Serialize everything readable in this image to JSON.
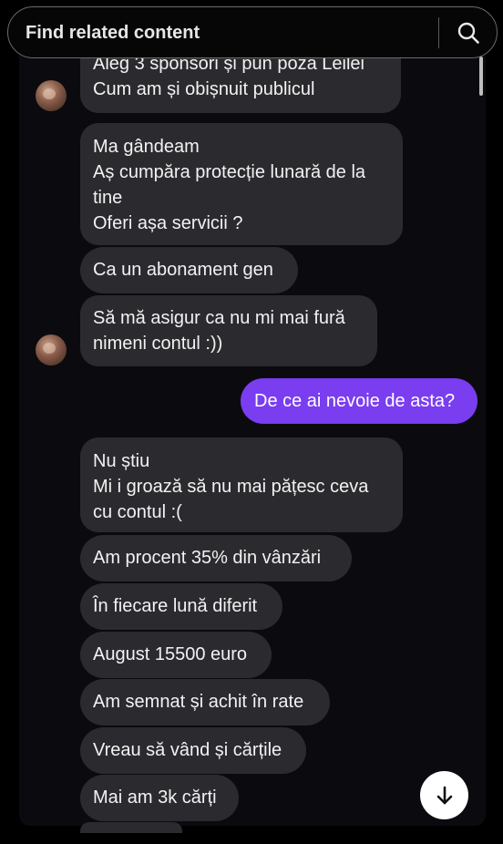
{
  "search": {
    "placeholder": "Find related content"
  },
  "messages": [
    {
      "id": "m1",
      "direction": "incoming",
      "text": "Aleg 3 sponsori și pun poză Leilei\nCum am și obișnuit publicul"
    },
    {
      "id": "m2",
      "direction": "incoming",
      "text": "Ma gândeam\nAș cumpăra protecție lunară de la\ntine\nOferi așa servicii ?"
    },
    {
      "id": "m3",
      "direction": "incoming",
      "text": "Ca un abonament gen"
    },
    {
      "id": "m4",
      "direction": "incoming",
      "text": "Să mă asigur ca nu mi mai fură\nnimeni contul :))"
    },
    {
      "id": "m5",
      "direction": "outgoing",
      "text": "De ce ai nevoie de asta?"
    },
    {
      "id": "m6",
      "direction": "incoming",
      "text": "Nu știu\nMi i groază să nu mai pățesc ceva\ncu contul :("
    },
    {
      "id": "m7",
      "direction": "incoming",
      "text": "Am procent 35% din vânzări"
    },
    {
      "id": "m8",
      "direction": "incoming",
      "text": "În fiecare lună diferit"
    },
    {
      "id": "m9",
      "direction": "incoming",
      "text": "August 15500 euro"
    },
    {
      "id": "m10",
      "direction": "incoming",
      "text": "Am semnat și achit în rate"
    },
    {
      "id": "m11",
      "direction": "incoming",
      "text": "Vreau să vând și cărțile"
    },
    {
      "id": "m12",
      "direction": "incoming",
      "text": "Mai am 3k cărți"
    }
  ],
  "icons": {
    "search": "search-icon",
    "scroll_down": "arrow-down-icon",
    "avatar": "avatar"
  },
  "colors": {
    "incoming_bubble": "#2b2b2f",
    "outgoing_bubble": "#7a3df0",
    "background": "#0b0b0f"
  }
}
